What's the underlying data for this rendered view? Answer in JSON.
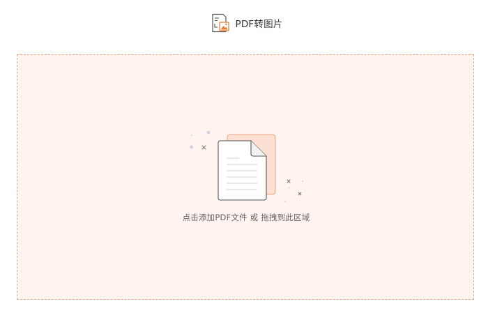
{
  "header": {
    "title": "PDF转图片",
    "icon": "pdf-to-image-icon"
  },
  "dropzone": {
    "hint": "点击添加PDF文件 或 拖拽到此区域",
    "illustration_icon": "document-upload-illustration"
  },
  "colors": {
    "accent": "#e8a383",
    "dropzone_bg": "#fff4f0",
    "back_doc_fill": "#fce0d3",
    "text_primary": "#333333",
    "text_secondary": "#666666"
  }
}
